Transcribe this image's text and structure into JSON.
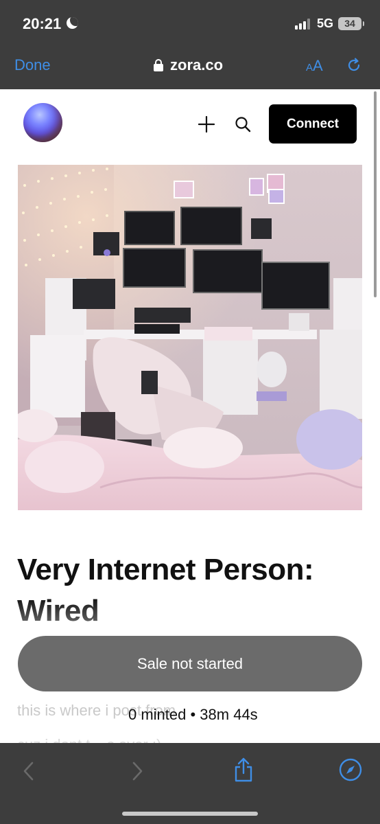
{
  "status_bar": {
    "time": "20:21",
    "network": "5G",
    "battery": "34"
  },
  "browser": {
    "done_label": "Done",
    "url": "zora.co",
    "text_size_small": "A",
    "text_size_large": "A"
  },
  "header": {
    "connect_label": "Connect"
  },
  "artwork": {
    "description_icon": "artwork-image"
  },
  "nft": {
    "title_line1": "Very Internet Person:",
    "title_line2": "Wired",
    "sale_label": "Sale not started",
    "minted_label": "0 minted • 38m 44s",
    "description_line1": "this is where i post from",
    "description_line2": "cuz i dont t... s ever ;)"
  },
  "colors": {
    "accent": "#3f8ee6",
    "chrome": "#3d3d3d",
    "button_dark": "#000000",
    "sale_button": "#6b6b6b"
  }
}
